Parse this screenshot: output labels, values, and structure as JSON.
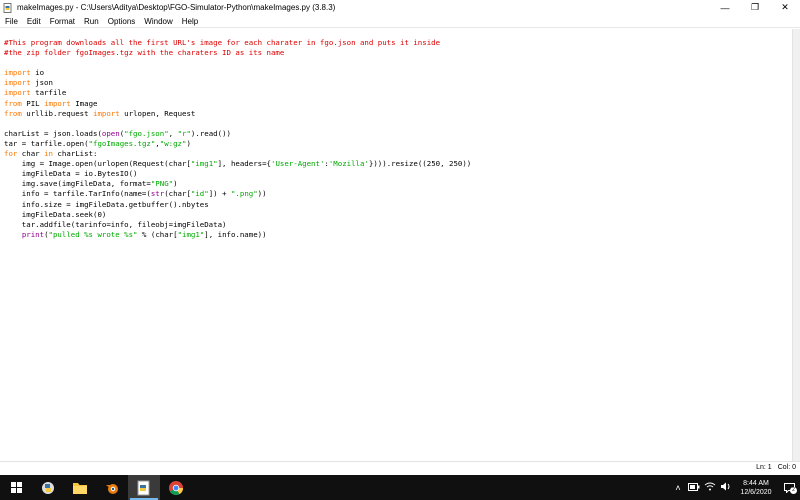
{
  "window": {
    "title": "makeImages.py - C:\\Users\\Aditya\\Desktop\\FGO-Simulator-Python\\makeImages.py (3.8.3)",
    "controls": {
      "minimize": "—",
      "maximize": "❐",
      "close": "✕"
    }
  },
  "menu": [
    "File",
    "Edit",
    "Format",
    "Run",
    "Options",
    "Window",
    "Help"
  ],
  "code_lines": [
    [
      {
        "t": "cm",
        "v": "#This program downloads all the first URL's image for each charater in fgo.json and puts it inside"
      }
    ],
    [
      {
        "t": "cm",
        "v": "#the zip folder fgoImages.tgz with the charaters ID as its name"
      }
    ],
    [],
    [
      {
        "t": "kw",
        "v": "import"
      },
      {
        "t": "",
        "v": " io"
      }
    ],
    [
      {
        "t": "kw",
        "v": "import"
      },
      {
        "t": "",
        "v": " json"
      }
    ],
    [
      {
        "t": "kw",
        "v": "import"
      },
      {
        "t": "",
        "v": " tarfile"
      }
    ],
    [
      {
        "t": "kw",
        "v": "from"
      },
      {
        "t": "",
        "v": " PIL "
      },
      {
        "t": "kw",
        "v": "import"
      },
      {
        "t": "",
        "v": " Image"
      }
    ],
    [
      {
        "t": "kw",
        "v": "from"
      },
      {
        "t": "",
        "v": " urllib.request "
      },
      {
        "t": "kw",
        "v": "import"
      },
      {
        "t": "",
        "v": " urlopen, Request"
      }
    ],
    [],
    [
      {
        "t": "",
        "v": "charList = json.loads("
      },
      {
        "t": "bi",
        "v": "open"
      },
      {
        "t": "",
        "v": "("
      },
      {
        "t": "st",
        "v": "\"fgo.json\""
      },
      {
        "t": "",
        "v": ", "
      },
      {
        "t": "st",
        "v": "\"r\""
      },
      {
        "t": "",
        "v": ").read())"
      }
    ],
    [
      {
        "t": "",
        "v": "tar = tarfile.open("
      },
      {
        "t": "st",
        "v": "\"fgoImages.tgz\""
      },
      {
        "t": "",
        "v": ","
      },
      {
        "t": "st",
        "v": "\"w:gz\""
      },
      {
        "t": "",
        "v": ")"
      }
    ],
    [
      {
        "t": "kw",
        "v": "for"
      },
      {
        "t": "",
        "v": " char "
      },
      {
        "t": "kw",
        "v": "in"
      },
      {
        "t": "",
        "v": " charList:"
      }
    ],
    [
      {
        "t": "",
        "v": "    img = Image.open(urlopen(Request(char["
      },
      {
        "t": "st",
        "v": "\"img1\""
      },
      {
        "t": "",
        "v": "], headers={"
      },
      {
        "t": "st",
        "v": "'User-Agent'"
      },
      {
        "t": "",
        "v": ":"
      },
      {
        "t": "st",
        "v": "'Mozilla'"
      },
      {
        "t": "",
        "v": "}))).resize((250, 250))"
      }
    ],
    [
      {
        "t": "",
        "v": "    imgFileData = io.BytesIO()"
      }
    ],
    [
      {
        "t": "",
        "v": "    img.save(imgFileData, format="
      },
      {
        "t": "st",
        "v": "\"PNG\""
      },
      {
        "t": "",
        "v": ")"
      }
    ],
    [
      {
        "t": "",
        "v": "    info = tarfile.TarInfo(name=("
      },
      {
        "t": "bi",
        "v": "str"
      },
      {
        "t": "",
        "v": "(char["
      },
      {
        "t": "st",
        "v": "\"id\""
      },
      {
        "t": "",
        "v": "]) + "
      },
      {
        "t": "st",
        "v": "\".png\""
      },
      {
        "t": "",
        "v": "))"
      }
    ],
    [
      {
        "t": "",
        "v": "    info.size = imgFileData.getbuffer().nbytes"
      }
    ],
    [
      {
        "t": "",
        "v": "    imgFileData.seek(0)"
      }
    ],
    [
      {
        "t": "",
        "v": "    tar.addfile(tarinfo=info, fileobj=imgFileData)"
      }
    ],
    [
      {
        "t": "",
        "v": "    "
      },
      {
        "t": "bi",
        "v": "print"
      },
      {
        "t": "",
        "v": "("
      },
      {
        "t": "st",
        "v": "\"pulled %s wrote %s\""
      },
      {
        "t": "",
        "v": " % (char["
      },
      {
        "t": "st",
        "v": "\"img1\""
      },
      {
        "t": "",
        "v": "], info.name))"
      }
    ]
  ],
  "status": {
    "line": "Ln: 1",
    "col": "Col: 0"
  },
  "taskbar": {
    "apps": [
      "windows-start",
      "idle-python",
      "file-explorer",
      "blender",
      "notepad-file",
      "chrome"
    ],
    "clock_time": "8:44 AM",
    "clock_date": "12/6/2020",
    "notification_count": "2"
  },
  "colors": {
    "keyword": "#ff7700",
    "comment": "#dd0000",
    "string": "#00aa00",
    "builtin": "#900090",
    "taskbar": "#101010"
  }
}
